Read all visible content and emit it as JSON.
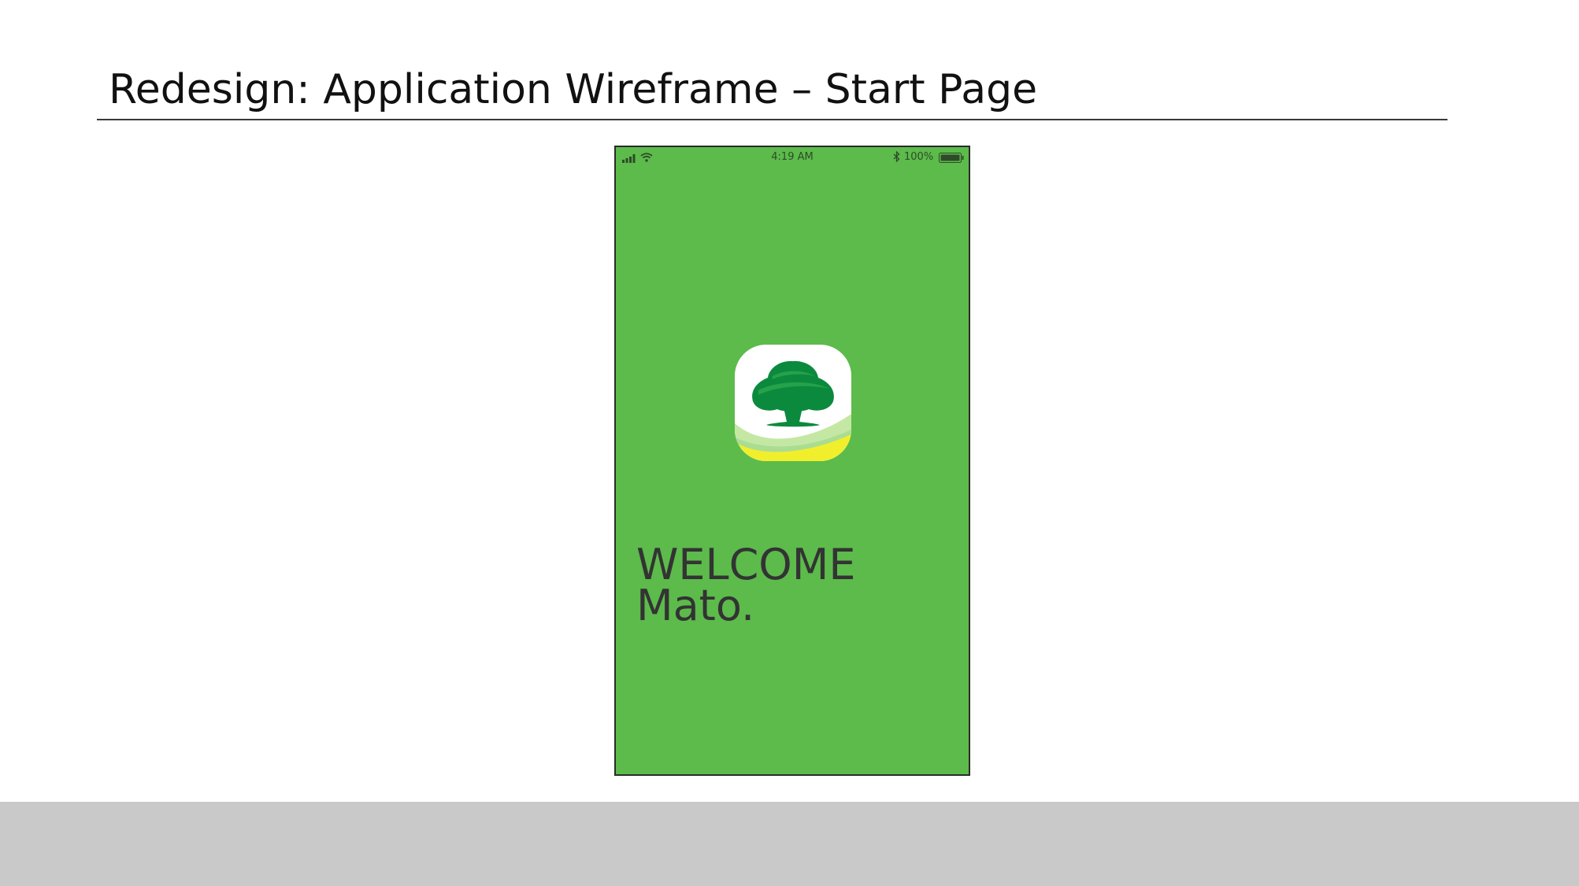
{
  "slide": {
    "title": "Redesign: Application Wireframe – Start Page"
  },
  "phone": {
    "status_bar": {
      "time": "4:19 AM",
      "battery_percent": "100%",
      "icons": [
        "signal-icon",
        "wifi-icon",
        "bluetooth-icon",
        "battery-icon"
      ]
    },
    "app_icon": "tree-logo-icon",
    "welcome": {
      "line1": "WELCOME",
      "line2": "Mato."
    }
  },
  "colors": {
    "phone_background": "#5cbb4b",
    "logo_dark_green": "#0b8a3e",
    "logo_mid_green": "#25a24a",
    "logo_light_green": "#c4e8a4",
    "logo_yellow": "#f1ef2c",
    "welcome_text": "#333333",
    "bottom_band": "#c9c9c9"
  }
}
